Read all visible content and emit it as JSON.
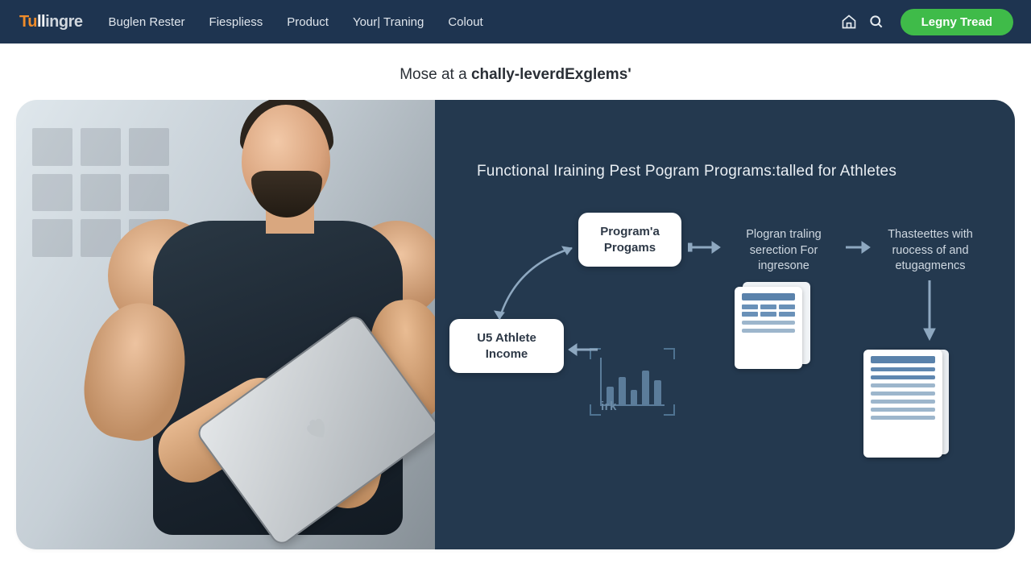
{
  "brand": {
    "p1": "Tu",
    "p2": "ll",
    "p3": "ingre"
  },
  "nav": {
    "item1": "Buglen Rester",
    "item2": "Fiespliess",
    "item3": "Product",
    "item4": "Your| Traning",
    "item5": "Colout"
  },
  "cta": "Legny Tread",
  "subtitle": {
    "prefix": "Mose at a ",
    "emph": "chally-leverdExglems'"
  },
  "hero": {
    "title": "Functional Iraining Pest Pogram Programs:talled for Athletes",
    "card_programs_l1": "Program'a",
    "card_programs_l2": "Progams",
    "card_income_l1": "U5 Athlete",
    "card_income_l2": "Income",
    "step1_l1": "Plogran traling",
    "step1_l2": "serection For",
    "step1_l3": "ingresone",
    "step2_l1": "Thasteettes with",
    "step2_l2": "ruocess of and",
    "step2_l3": "etugagmencs",
    "chart_label": "irk"
  },
  "colors": {
    "header_bg": "#1e3450",
    "cta_bg": "#3fbb49",
    "panel_bg": "#24394f",
    "accent_orange": "#f08c2a"
  }
}
